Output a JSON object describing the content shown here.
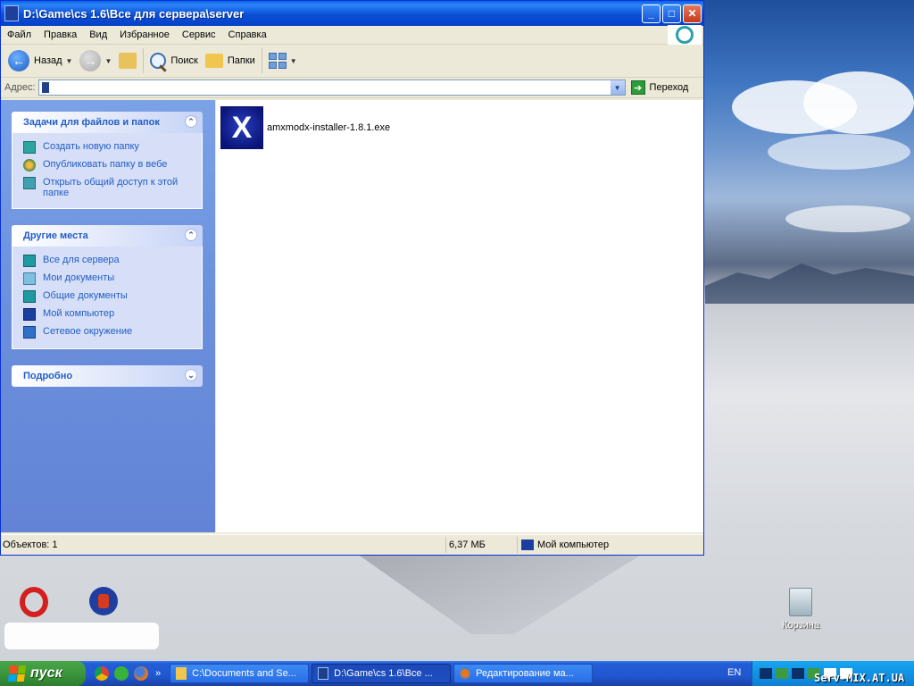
{
  "window": {
    "title": "D:\\Game\\cs 1.6\\Все для сервера\\server",
    "minimize": "_",
    "maximize": "□",
    "close": "✕"
  },
  "menu": [
    "Файл",
    "Правка",
    "Вид",
    "Избранное",
    "Сервис",
    "Справка"
  ],
  "toolbar": {
    "back_label": "Назад",
    "search_label": "Поиск",
    "folders_label": "Папки"
  },
  "address": {
    "label": "Адрес:",
    "value": "",
    "go_label": "Переход"
  },
  "left_panel": {
    "tasks": {
      "title": "Задачи для файлов и папок",
      "items": [
        {
          "label": "Создать новую папку",
          "icon": "new-folder-icon"
        },
        {
          "label": "Опубликовать папку в вебе",
          "icon": "publish-web-icon"
        },
        {
          "label": "Открыть общий доступ к этой папке",
          "icon": "share-folder-icon"
        }
      ]
    },
    "other_places": {
      "title": "Другие места",
      "items": [
        {
          "label": "Все для сервера",
          "icon": "folder-icon"
        },
        {
          "label": "Мои документы",
          "icon": "my-documents-icon"
        },
        {
          "label": "Общие документы",
          "icon": "shared-documents-icon"
        },
        {
          "label": "Мой компьютер",
          "icon": "my-computer-icon"
        },
        {
          "label": "Сетевое окружение",
          "icon": "network-icon"
        }
      ]
    },
    "details": {
      "title": "Подробно"
    }
  },
  "files": [
    {
      "name": "amxmodx-installer-1.8.1.exe",
      "icon": "installer-icon"
    }
  ],
  "status": {
    "objects": "Объектов: 1",
    "size": "6,37 МБ",
    "location": "Мой компьютер"
  },
  "desktop": {
    "recycle_bin_label": "Корзина"
  },
  "taskbar": {
    "start_label": "пуск",
    "quicklaunch_more": "»",
    "tasks": [
      {
        "label": "C:\\Documents and Se...",
        "icon": "folder-icon",
        "active": false
      },
      {
        "label": "D:\\Game\\cs 1.6\\Все ...",
        "icon": "book-icon",
        "active": true
      },
      {
        "label": "Редактирование ма...",
        "icon": "firefox-icon",
        "active": false
      }
    ],
    "language": "EN",
    "watermark": "Serv-MIX.AT.UA"
  }
}
